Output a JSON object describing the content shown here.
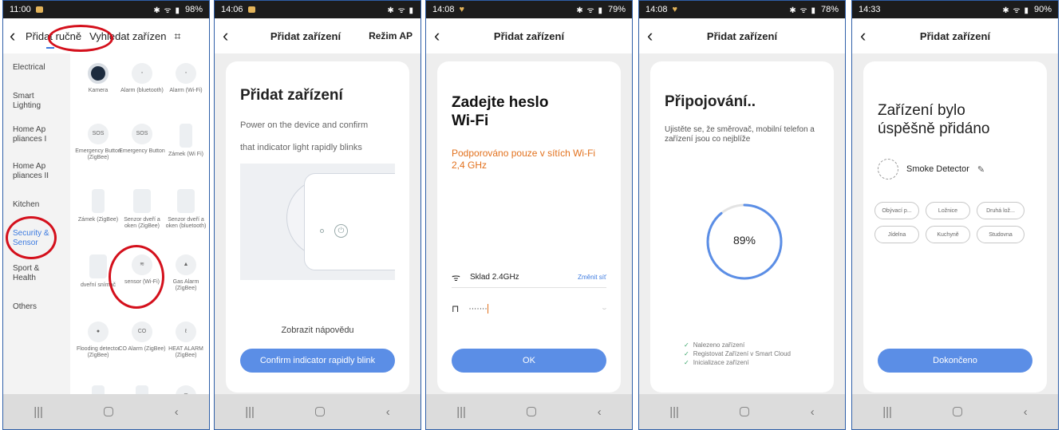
{
  "screen1": {
    "status": {
      "time": "11:00",
      "battery": "98%"
    },
    "tabs": {
      "manual": "Přidat ručně",
      "search": "Vyhledat zařízen"
    },
    "sidebar": [
      "Electrical",
      "Smart Lighting",
      "Home Ap pliances I",
      "Home Ap pliances II",
      "Kitchen",
      "Security & Sensor",
      "Sport & Health",
      "Others"
    ],
    "devices": [
      "Kamera",
      "Alarm (bluetooth)",
      "Alarm (Wi-Fi)",
      "Emergency Button (ZigBee)",
      "Emergency Button",
      "Zámek (Wi Fi)",
      "Zámek (ZigBee)",
      "Senzor dveří a oken (ZigBee)",
      "Senzor dveří a oken (bluetooth)",
      "dveřní snímač",
      "sensor (Wi-Fi)",
      "Gas Alarm (ZigBee)",
      "Flooding detector (ZigBee)",
      "CO Alarm (ZigBee)",
      "HEAT ALARM (ZigBee)"
    ],
    "sos": "SOS",
    "co": "CO",
    "highlight_color": "#d4101c",
    "accent_color": "#3d7be0"
  },
  "screen2": {
    "status": {
      "time": "14:06"
    },
    "title": "Přidat zařízení",
    "mode": "Režim AP",
    "heading": "Přidat zařízení",
    "line1": "Power on the device and confirm",
    "line2": "that indicator light rapidly blinks",
    "help": "Zobrazit nápovědu",
    "button": "Confirm indicator rapidly blink"
  },
  "screen3": {
    "status": {
      "time": "14:08",
      "battery": "79%"
    },
    "title": "Přidat zařízení",
    "heading1": "Zadejte heslo",
    "heading2": "Wi-Fi",
    "warning": "Podporováno pouze v sítích Wi-Fi 2,4 GHz",
    "ssid": "Sklad 2.4GHz",
    "change": "Změnit síť",
    "password": "·······",
    "button": "OK",
    "warn_color": "#e2711d"
  },
  "screen4": {
    "status": {
      "time": "14:08",
      "battery": "78%"
    },
    "title": "Přidat zařízení",
    "heading": "Připojování..",
    "subtitle": "Ujistěte se, že směrovač, mobilní telefon a zařízení jsou co nejblíže",
    "progress_fraction": 0.89,
    "progress_label": "89%",
    "steps": [
      "Nalezeno zařízení",
      "Registovat Zařízení v Smart Cloud",
      "Inicializace zařízení"
    ]
  },
  "screen5": {
    "status": {
      "time": "14:33",
      "battery": "90%"
    },
    "title": "Přidat zařízení",
    "heading1": "Zařízení bylo",
    "heading2": "úspěšně přidáno",
    "device": "Smoke Detector",
    "rooms": [
      "Obývací p...",
      "Ložnice",
      "Druhá lož...",
      "Jídelna",
      "Kuchyně",
      "Studovna"
    ],
    "button": "Dokončeno"
  }
}
